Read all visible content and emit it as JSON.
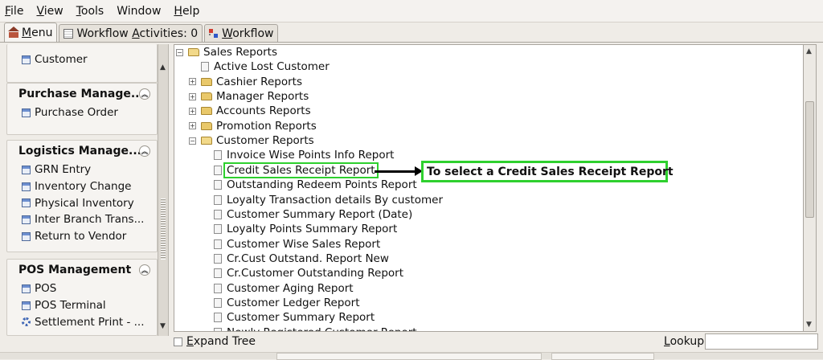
{
  "menubar": {
    "items": [
      {
        "label": "File",
        "mnemonic": "F",
        "rest": "ile"
      },
      {
        "label": "View",
        "mnemonic": "V",
        "rest": "iew"
      },
      {
        "label": "Tools",
        "mnemonic": "T",
        "rest": "ools"
      },
      {
        "label": "Window",
        "mnemonic": "",
        "rest": "Window"
      },
      {
        "label": "Help",
        "mnemonic": "H",
        "rest": "elp"
      }
    ]
  },
  "tabs": [
    {
      "pre": "",
      "mnemonic": "M",
      "rest": "enu",
      "icon": "home-icon"
    },
    {
      "pre": "Workflow ",
      "mnemonic": "A",
      "rest": "ctivities: 0",
      "icon": "table-icon"
    },
    {
      "pre": "",
      "mnemonic": "W",
      "rest": "orkflow",
      "icon": "workflow-icon"
    }
  ],
  "sidebar": {
    "top_item": "Customer",
    "sections": [
      {
        "title": "Purchase Manage...",
        "items": [
          "Purchase Order"
        ]
      },
      {
        "title": "Logistics Manage...",
        "items": [
          "GRN Entry",
          "Inventory Change",
          "Physical Inventory",
          "Inter Branch Trans...",
          "Return to Vendor"
        ]
      },
      {
        "title": "POS Management",
        "items": [
          "POS",
          "POS Terminal",
          "Settlement Print - ..."
        ]
      }
    ]
  },
  "tree": {
    "root": "Sales Reports",
    "root_children": [
      {
        "label": "Active Lost Customer",
        "type": "leaf"
      },
      {
        "label": "Cashier Reports",
        "type": "folder"
      },
      {
        "label": "Manager Reports",
        "type": "folder"
      },
      {
        "label": "Accounts Reports",
        "type": "folder"
      },
      {
        "label": "Promotion Reports",
        "type": "folder"
      },
      {
        "label": "Customer Reports",
        "type": "folder-open"
      }
    ],
    "customer_reports": [
      "Invoice Wise Points Info Report",
      "Credit Sales Receipt Report",
      "Outstanding Redeem Points Report",
      "Loyalty Transaction details By customer",
      "Customer Summary Report (Date)",
      "Loyalty Points Summary Report",
      "Customer Wise Sales Report",
      "Cr.Cust Outstand. Report New",
      "Cr.Customer Outstanding Report",
      "Customer Aging Report",
      "Customer Ledger Report",
      "Customer Summary Report",
      "Newly Registered Customer Report"
    ],
    "highlighted_index": 1
  },
  "annotation": {
    "text": "To select a Credit Sales Receipt Report",
    "color": "#2ed02e"
  },
  "bottom": {
    "expand_tree": {
      "mnemonic": "E",
      "rest": "xpand Tree"
    },
    "lookup": {
      "mnemonic": "L",
      "rest": "ookup",
      "value": ""
    }
  }
}
